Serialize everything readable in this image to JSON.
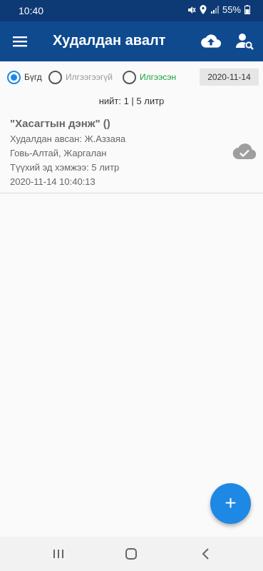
{
  "status_bar": {
    "time": "10:40",
    "battery": "55%"
  },
  "app_bar": {
    "title": "Худалдан авалт",
    "menu_icon": "menu-icon",
    "upload_icon": "cloud-upload-icon",
    "user_search_icon": "user-search-icon"
  },
  "filters": {
    "options": [
      "Бүгд",
      "Илгээгээгүй",
      "Илгээсэн"
    ],
    "selected": "Бүгд",
    "date": "2020-11-14"
  },
  "summary": "нийт: 1 | 5 литр",
  "records": [
    {
      "name": "\"Хасагтын дэнж\" ()",
      "buyer": "Худалдан авсан: Ж.Аззаяа",
      "location": "Говь-Алтай, Жаргалан",
      "quantity": "Түүхий эд хэмжээ: 5 литр",
      "datetime": "2020-11-14 10:40:13",
      "status_icon": "cloud-done-icon"
    }
  ],
  "fab": {
    "label": "+"
  },
  "colors": {
    "primary": "#0f4a8f",
    "status_bar": "#0d3a75",
    "accent": "#1e88e5",
    "sent_green": "#1aa33a"
  }
}
